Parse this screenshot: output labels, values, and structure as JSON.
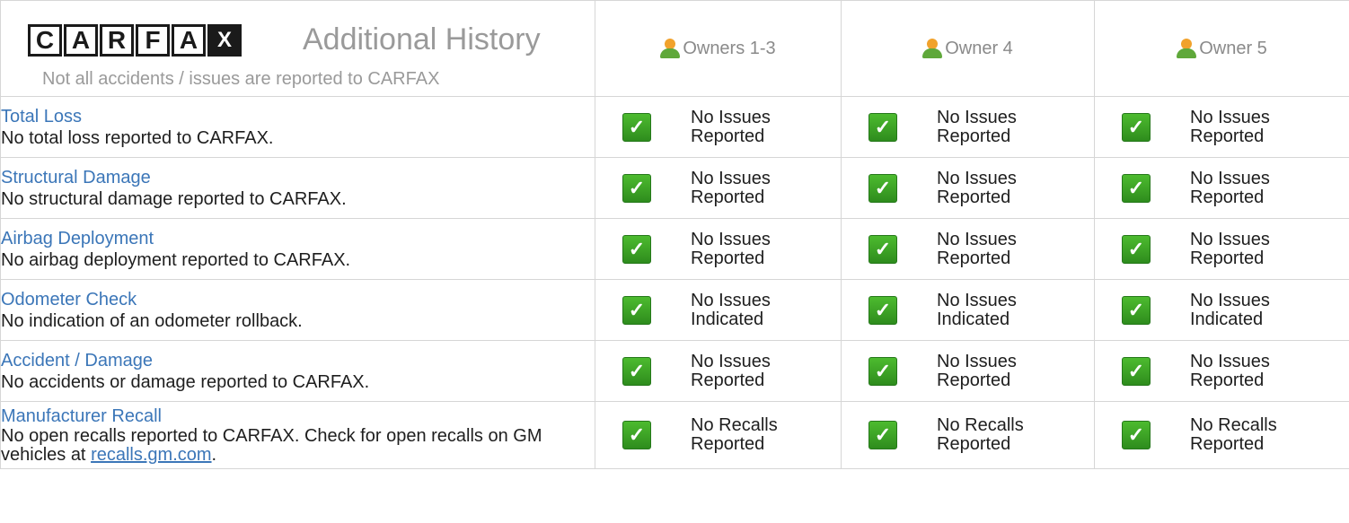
{
  "brand": {
    "logo_letters": [
      "C",
      "A",
      "R",
      "F",
      "A",
      "X"
    ]
  },
  "header": {
    "title": "Additional History",
    "subtitle": "Not all accidents / issues are reported to CARFAX"
  },
  "owners": [
    {
      "label": "Owners 1-3"
    },
    {
      "label": "Owner 4"
    },
    {
      "label": "Owner 5"
    }
  ],
  "rows": [
    {
      "title": "Total Loss",
      "desc": "No total loss reported to CARFAX.",
      "status": [
        {
          "line1": "No Issues",
          "line2": "Reported"
        },
        {
          "line1": "No Issues",
          "line2": "Reported"
        },
        {
          "line1": "No Issues",
          "line2": "Reported"
        }
      ]
    },
    {
      "title": "Structural Damage",
      "desc": "No structural damage reported to CARFAX.",
      "status": [
        {
          "line1": "No Issues",
          "line2": "Reported"
        },
        {
          "line1": "No Issues",
          "line2": "Reported"
        },
        {
          "line1": "No Issues",
          "line2": "Reported"
        }
      ]
    },
    {
      "title": "Airbag Deployment",
      "desc": "No airbag deployment reported to CARFAX.",
      "status": [
        {
          "line1": "No Issues",
          "line2": "Reported"
        },
        {
          "line1": "No Issues",
          "line2": "Reported"
        },
        {
          "line1": "No Issues",
          "line2": "Reported"
        }
      ]
    },
    {
      "title": "Odometer Check",
      "desc": "No indication of an odometer rollback.",
      "status": [
        {
          "line1": "No Issues",
          "line2": "Indicated"
        },
        {
          "line1": "No Issues",
          "line2": "Indicated"
        },
        {
          "line1": "No Issues",
          "line2": "Indicated"
        }
      ]
    },
    {
      "title": "Accident / Damage",
      "desc": "No accidents or damage reported to CARFAX.",
      "status": [
        {
          "line1": "No Issues",
          "line2": "Reported"
        },
        {
          "line1": "No Issues",
          "line2": "Reported"
        },
        {
          "line1": "No Issues",
          "line2": "Reported"
        }
      ]
    },
    {
      "title": "Manufacturer Recall",
      "desc_part1": "No open recalls reported to CARFAX. Check for open recalls on GM vehicles at ",
      "desc_link": "recalls.gm.com",
      "desc_part2": ".",
      "status": [
        {
          "line1": "No Recalls",
          "line2": "Reported"
        },
        {
          "line1": "No Recalls",
          "line2": "Reported"
        },
        {
          "line1": "No Recalls",
          "line2": "Reported"
        }
      ]
    }
  ],
  "icons": {
    "owner": "person-icon",
    "status": "green-check-icon"
  },
  "colors": {
    "link": "#3b76b8",
    "muted": "#9a9a9a",
    "check_green": "#3aa428",
    "person_head": "#f1a22c",
    "person_body": "#5fa83a"
  }
}
